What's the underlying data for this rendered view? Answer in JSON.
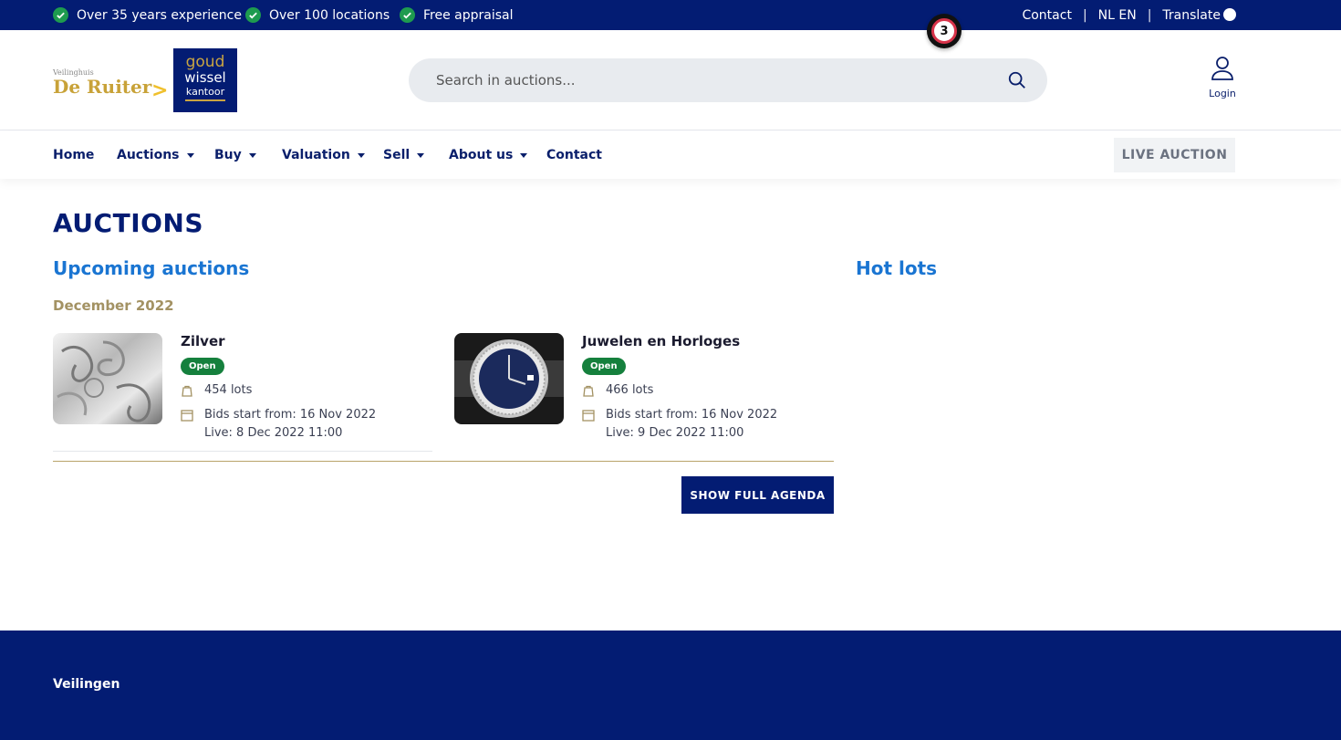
{
  "topbar": {
    "usps": [
      "Over 35 years experience",
      "Over 100 locations",
      "Free appraisal"
    ],
    "contact": "Contact",
    "languages": "NL EN",
    "translate": "Translate",
    "separator": "|"
  },
  "notification_badge": "3",
  "header": {
    "logo_small": "Veilinghuis",
    "logo_name": "De Ruiter",
    "logo_arrow": ">",
    "logo2_line1": "goud",
    "logo2_line2": "wissel",
    "logo2_line3": "kantoor",
    "search_placeholder": "Search in auctions...",
    "login": "Login"
  },
  "nav": {
    "items": [
      {
        "label": "Home",
        "dropdown": false
      },
      {
        "label": "Auctions",
        "dropdown": true
      },
      {
        "label": "Buy",
        "dropdown": true
      },
      {
        "label": "Valuation",
        "dropdown": true
      },
      {
        "label": "Sell",
        "dropdown": true
      },
      {
        "label": "About us",
        "dropdown": true
      },
      {
        "label": "Contact",
        "dropdown": false
      }
    ],
    "live_button": "LIVE AUCTION"
  },
  "main": {
    "title": "AUCTIONS",
    "upcoming_heading": "Upcoming auctions",
    "hotlots_heading": "Hot lots",
    "month": "December 2022",
    "auctions": [
      {
        "name": "Zilver",
        "status": "Open",
        "lots": "454 lots",
        "bids_start": "Bids start from: 16 Nov 2022",
        "live": "Live: 8 Dec 2022 11:00"
      },
      {
        "name": "Juwelen en Horloges",
        "status": "Open",
        "lots": "466 lots",
        "bids_start": "Bids start from: 16 Nov 2022",
        "live": "Live: 9 Dec 2022 11:00"
      }
    ],
    "agenda_button": "SHOW FULL AGENDA"
  },
  "footer": {
    "title": "Veilingen"
  },
  "colors": {
    "navy": "#031c73",
    "blue_heading": "#1a75d2",
    "gold": "#c8a238",
    "open_green": "#15803d",
    "check_green": "#1e9b4f"
  }
}
